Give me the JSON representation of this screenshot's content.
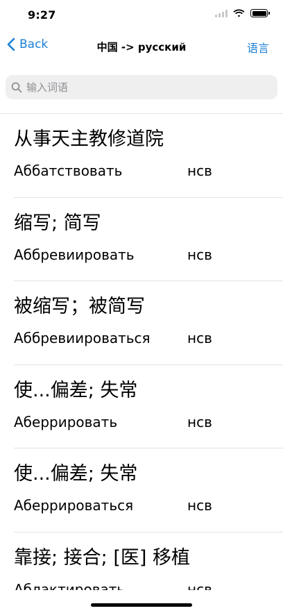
{
  "status_bar": {
    "time": "9:27"
  },
  "nav": {
    "back_label": "Back",
    "title": "中国 -> русский",
    "right_label": "语言"
  },
  "search": {
    "placeholder": "输入词语"
  },
  "entries": [
    {
      "zh": "从事天主教修道院",
      "ru": "Аббатствовать",
      "pos": "нсв"
    },
    {
      "zh": "缩写; 简写",
      "ru": "Аббревиировать",
      "pos": "нсв"
    },
    {
      "zh": "被缩写；被简写",
      "ru": "Аббревиироваться",
      "pos": "нсв"
    },
    {
      "zh": "使...偏差; 失常",
      "ru": "Аберрировать",
      "pos": "нсв"
    },
    {
      "zh": "使...偏差; 失常",
      "ru": "Аберрироваться",
      "pos": "нсв"
    },
    {
      "zh": "靠接; 接合; [医] 移植",
      "ru": "Аблактировать",
      "pos": "нсв"
    }
  ],
  "colors": {
    "accent": "#1a7fd6",
    "separator": "#e3e3e6",
    "search_bg": "#efeff0"
  }
}
